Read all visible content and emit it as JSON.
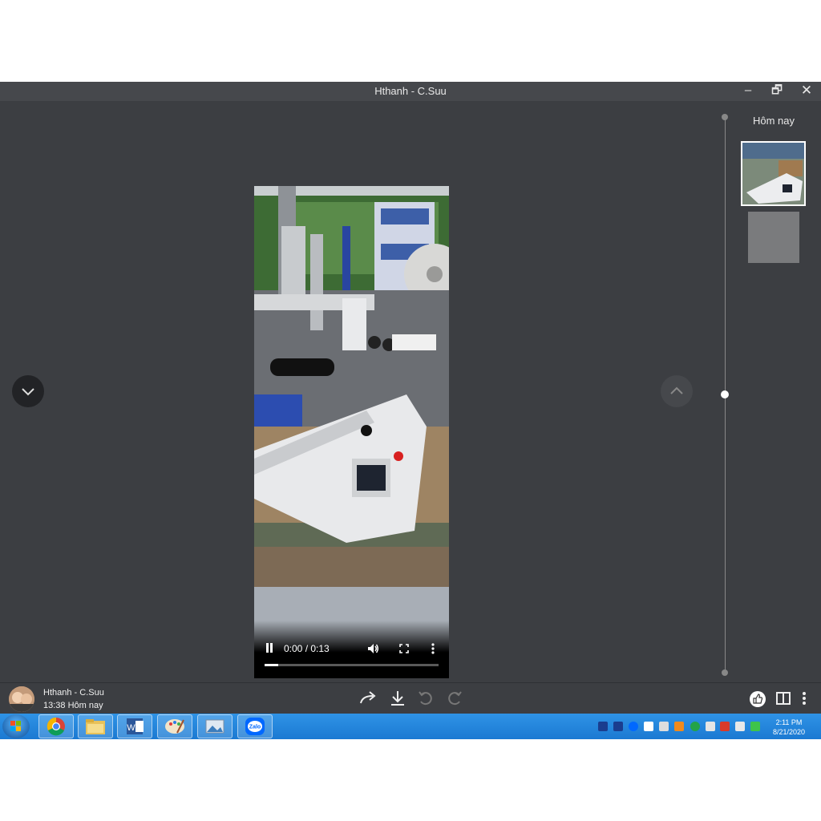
{
  "window": {
    "title": "Hthanh - C.Suu",
    "controls": {
      "minimize": "–",
      "maximize": "🗗",
      "close": "✕"
    }
  },
  "video": {
    "time": "0:00 / 0:13",
    "progress": 0.08,
    "state": "playing"
  },
  "timeline": {
    "group_label": "Hôm nay"
  },
  "message": {
    "sender": "Hthanh - C.Suu",
    "timestamp": "13:38 Hôm nay"
  },
  "bottom_actions": [
    "share-icon",
    "download-icon",
    "rotate-left-icon",
    "rotate-right-icon"
  ],
  "taskbar": {
    "apps": [
      "chrome-icon",
      "file-explorer-icon",
      "word-icon",
      "paint-icon",
      "photos-icon",
      "zalo-icon"
    ],
    "zalo_label": "Zalo",
    "word_label": "W",
    "clock_time": "2:11 PM",
    "clock_date": "8/21/2020"
  },
  "colors": {
    "window_bg": "#3c3e42",
    "taskbar": "#1b79d2",
    "accent": "#ffffff"
  }
}
